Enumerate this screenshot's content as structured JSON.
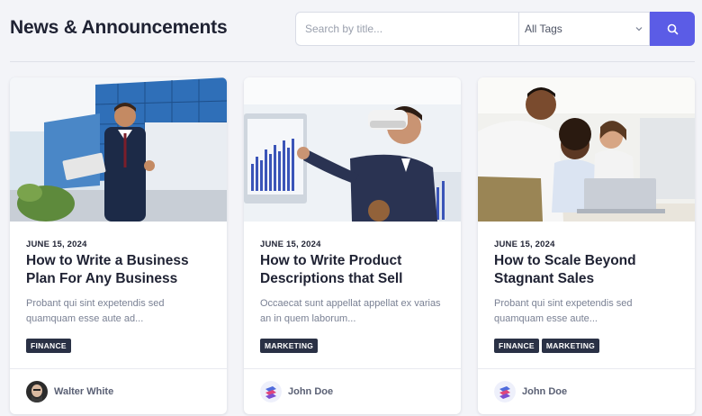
{
  "header": {
    "title": "News & Announcements",
    "search_placeholder": "Search by title...",
    "tag_select_value": "All Tags"
  },
  "colors": {
    "accent": "#5b5ce6",
    "tag_bg": "#2a3145",
    "background": "#f3f4f8"
  },
  "posts": [
    {
      "date": "JUNE 15, 2024",
      "title": "How to Write a Business Plan For Any Business",
      "excerpt": "Probant qui sint expetendis sed quamquam esse aute ad...",
      "tags": [
        "FINANCE"
      ],
      "author": "Walter White",
      "image": "businessman-thumbs-up-photo",
      "avatar": "walter-white-avatar"
    },
    {
      "date": "JUNE 15, 2024",
      "title": "How to Write Product Descriptions that Sell",
      "excerpt": "Occaecat sunt appellat appellat ex varias an in quem laborum...",
      "tags": [
        "MARKETING"
      ],
      "author": "John Doe",
      "image": "vr-headset-man-charts-photo",
      "avatar": "logo-avatar"
    },
    {
      "date": "JUNE 15, 2024",
      "title": "How to Scale Beyond Stagnant Sales",
      "excerpt": "Probant qui sint expetendis sed quamquam esse aute...",
      "tags": [
        "FINANCE",
        "MARKETING"
      ],
      "author": "John Doe",
      "image": "team-at-laptop-photo",
      "avatar": "logo-avatar"
    }
  ]
}
